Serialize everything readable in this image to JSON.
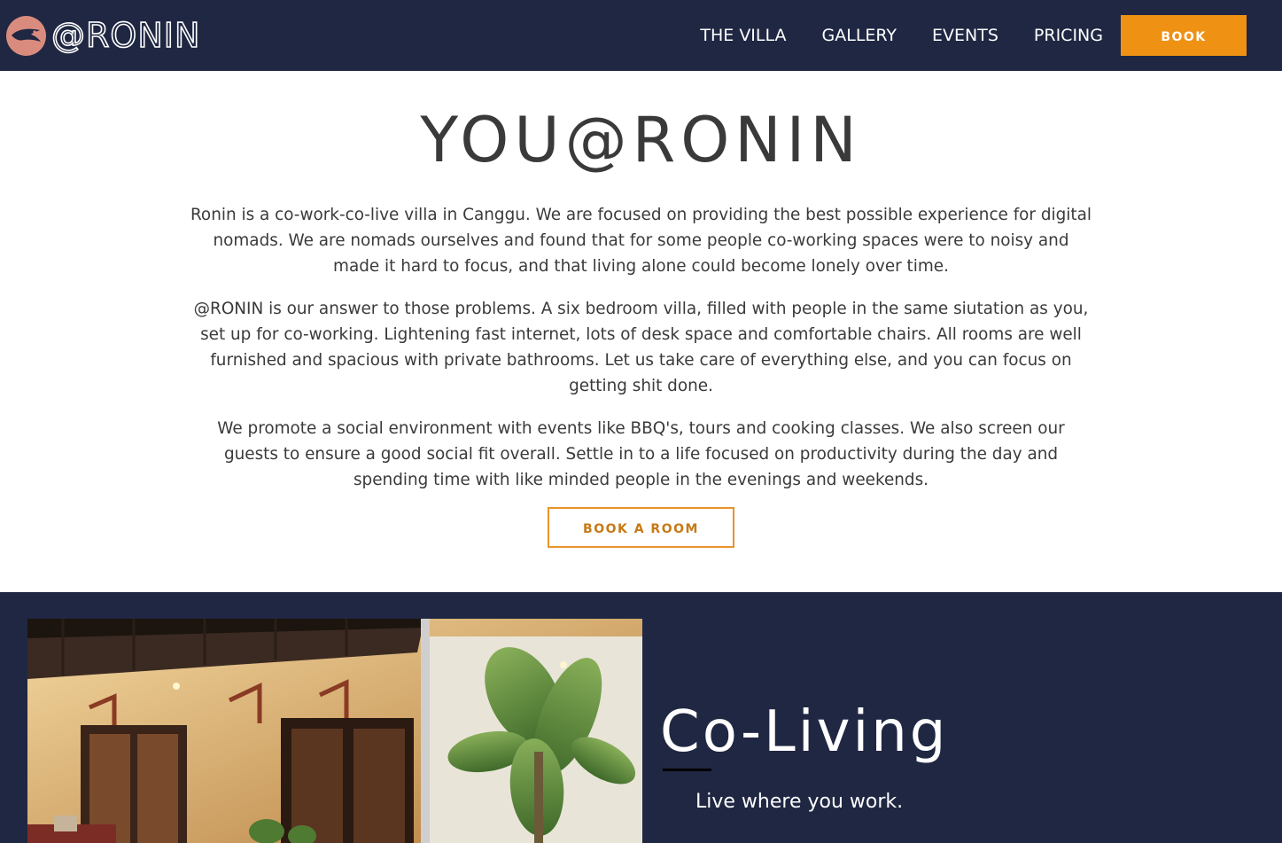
{
  "colors": {
    "nav_bg": "#1f2742",
    "accent": "#ef9214",
    "accent_text": "#c77a16",
    "body_text": "#3a3a3a",
    "logo_circle": "#d98c7e"
  },
  "nav": {
    "brand": {
      "logo_icon": "bird-logo-icon",
      "text": "@RONIN"
    },
    "links": [
      {
        "label": "THE VILLA"
      },
      {
        "label": "GALLERY"
      },
      {
        "label": "EVENTS"
      },
      {
        "label": "PRICING"
      }
    ],
    "book_label": "BOOK"
  },
  "intro": {
    "title": "YOU@RONIN",
    "paragraphs": [
      "Ronin is a co-work-co-live villa in Canggu. We are focused on providing the best possible experience for digital nomads. We are nomads ourselves and found that for some people co-working spaces were to noisy and made it hard to focus, and that living alone could become lonely over time.",
      "@RONIN is our answer to those problems. A six bedroom villa, filled with people in the same siutation as you, set up for co-working. Lightening fast internet, lots of desk space and comfortable chairs. All rooms are well furnished and spacious with private bathrooms. Let us take care of everything else, and you can focus on getting shit done.",
      "We promote a social environment with events like BBQ's, tours and cooking classes. We also screen our guests to ensure a good social fit overall. Settle in to a life focused on productivity during the day and spending time with like minded people in the evenings and weekends."
    ],
    "cta_label": "BOOK A ROOM"
  },
  "coliving": {
    "image_description_icon": "villa-patio-photo",
    "title": "Co-Living",
    "subtitle": "Live where you work."
  }
}
